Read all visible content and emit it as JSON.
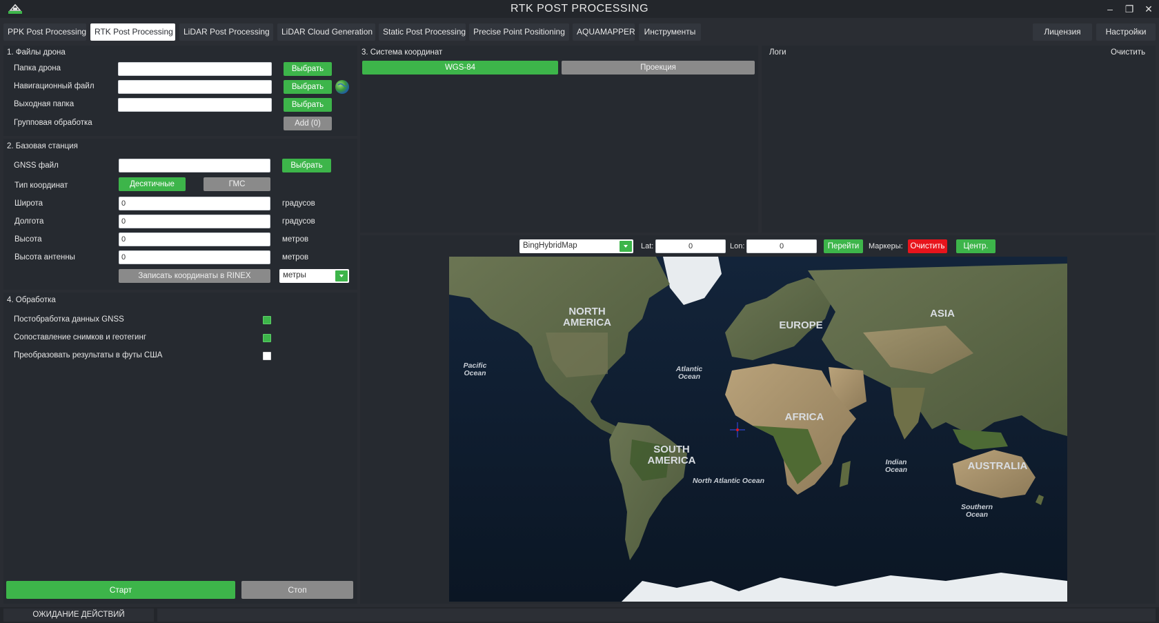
{
  "window": {
    "title": "RTK POST PROCESSING",
    "controls": {
      "minimize": "–",
      "restore": "❐",
      "close": "✕"
    }
  },
  "tabs": [
    {
      "label": "PPK Post Processing",
      "active": false
    },
    {
      "label": "RTK Post Processing",
      "active": true
    },
    {
      "label": "LiDAR Post Processing",
      "active": false
    },
    {
      "label": "LiDAR Cloud Generation",
      "active": false
    },
    {
      "label": "Static Post Processing",
      "active": false
    },
    {
      "label": "Precise Point Positioning",
      "active": false
    },
    {
      "label": "AQUAMAPPER",
      "active": false
    },
    {
      "label": "Инструменты",
      "active": false
    }
  ],
  "right_tabs": {
    "license": "Лицензия",
    "settings": "Настройки"
  },
  "drone_files": {
    "title": "1. Файлы дрона",
    "drone_folder": {
      "label": "Папка дрона",
      "value": "",
      "button": "Выбрать"
    },
    "nav_file": {
      "label": "Навигационный файл",
      "value": "",
      "button": "Выбрать"
    },
    "output_folder": {
      "label": "Выходная папка",
      "value": "",
      "button": "Выбрать"
    },
    "batch": {
      "label": "Групповая обработка",
      "button": "Add (0)"
    }
  },
  "base_station": {
    "title": "2. Базовая станция",
    "gnss_file": {
      "label": "GNSS файл",
      "value": "",
      "button": "Выбрать"
    },
    "coord_type": {
      "label": "Тип координат",
      "decimal": "Десятичные",
      "dms": "ГМС"
    },
    "latitude": {
      "label": "Широта",
      "value": "0",
      "unit": "градусов"
    },
    "longitude": {
      "label": "Долгота",
      "value": "0",
      "unit": "градусов"
    },
    "height": {
      "label": "Высота",
      "value": "0",
      "unit": "метров"
    },
    "antenna_height": {
      "label": "Высота антенны",
      "value": "0",
      "unit": "метров"
    },
    "write_rinex": "Записать координаты в RINEX",
    "units_select": "метры"
  },
  "processing": {
    "title": "4. Обработка",
    "options": [
      {
        "label": "Постобработка данных GNSS",
        "checked": true
      },
      {
        "label": "Сопоставление снимков и геотегинг",
        "checked": true
      },
      {
        "label": "Преобразовать результаты в футы США",
        "checked": false
      }
    ]
  },
  "actions": {
    "start": "Старт",
    "stop": "Стоп"
  },
  "coord_system": {
    "title": "3. Система координат",
    "wgs": "WGS-84",
    "projection": "Проекция"
  },
  "logs": {
    "title": "Логи",
    "clear": "Очистить"
  },
  "map_toolbar": {
    "map_type": "BingHybridMap",
    "lat_label": "Lat:",
    "lat_value": "0",
    "lon_label": "Lon:",
    "lon_value": "0",
    "go": "Перейти",
    "markers_label": "Маркеры:",
    "clear": "Очистить",
    "center": "Центр."
  },
  "map_labels": {
    "continents": [
      "NORTH AMERICA",
      "EUROPE",
      "ASIA",
      "AFRICA",
      "SOUTH AMERICA",
      "AUSTRALIA"
    ],
    "oceans": [
      "Pacific Ocean",
      "Atlantic Ocean",
      "North Atlantic Ocean",
      "Indian Ocean",
      "Southern Ocean"
    ]
  },
  "status": {
    "text": "ОЖИДАНИЕ ДЕЙСТВИЙ"
  },
  "colors": {
    "accent_green": "#3db54a",
    "danger_red": "#e8141c",
    "neutral_gray": "#8a8a8a",
    "panel_bg": "#262a30",
    "window_bg": "#2a2d33"
  }
}
